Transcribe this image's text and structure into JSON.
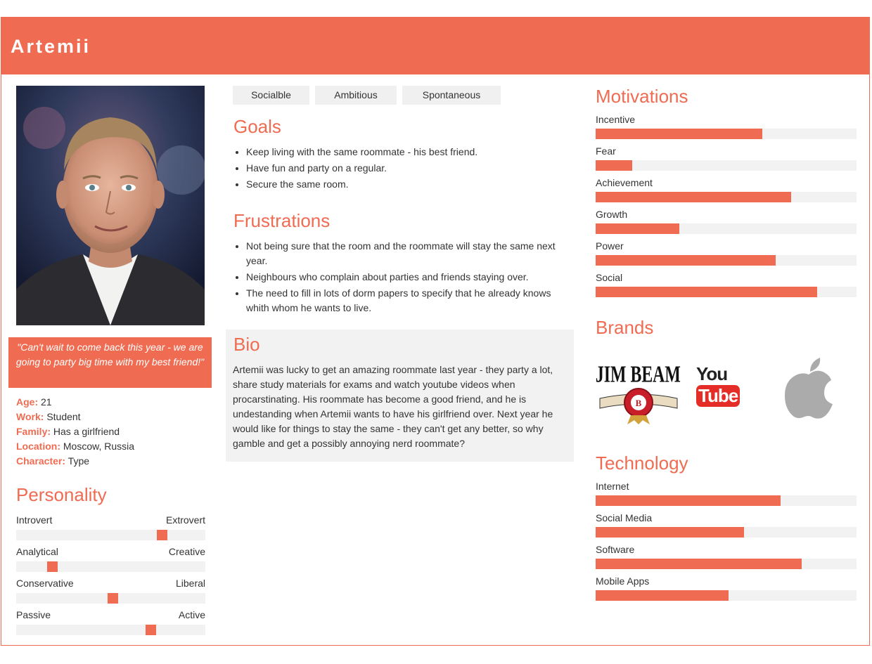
{
  "persona": {
    "name": "Artemii",
    "quote": "\"Can't wait to come back this year - we are going to party big time with my best friend!\"",
    "facts": [
      {
        "key": "Age:",
        "value": "21"
      },
      {
        "key": "Work:",
        "value": "Student"
      },
      {
        "key": "Family:",
        "value": "Has a girlfriend"
      },
      {
        "key": "Location:",
        "value": "Moscow, Russia"
      },
      {
        "key": "Character:",
        "value": "Type"
      }
    ]
  },
  "personality": {
    "title": "Personality",
    "scales": [
      {
        "left": "Introvert",
        "right": "Extrovert",
        "value": 0.77
      },
      {
        "left": "Analytical",
        "right": "Creative",
        "value": 0.19
      },
      {
        "left": "Conservative",
        "right": "Liberal",
        "value": 0.51
      },
      {
        "left": "Passive",
        "right": "Active",
        "value": 0.71
      }
    ]
  },
  "tags": [
    "Socialble",
    "Ambitious",
    "Spontaneous"
  ],
  "goals": {
    "title": "Goals",
    "items": [
      "Keep living with the same roommate - his best friend.",
      "Have fun and party on a regular.",
      "Secure the same room."
    ]
  },
  "frustrations": {
    "title": "Frustrations",
    "items": [
      "Not being sure that the room and the roommate will stay the same next year.",
      "Neighbours who complain about parties and friends staying over.",
      "The need to fill in lots of dorm papers to specify that he already knows whith whom he wants to live."
    ]
  },
  "bio": {
    "title": "Bio",
    "text": "Artemii was lucky to get an amazing roommate last year - they party a lot, share study materials for exams and watch youtube videos when procarstinating. His roommate has become a good friend, and he is undestanding when Artemii wants to have his girlfriend over. Next year he would like for things to stay the same - they can't get any better, so why gamble and get a possibly annoying nerd roommate?"
  },
  "motivations": {
    "title": "Motivations",
    "items": [
      {
        "label": "Incentive",
        "value": 0.64
      },
      {
        "label": "Fear",
        "value": 0.14
      },
      {
        "label": "Achievement",
        "value": 0.75
      },
      {
        "label": "Growth",
        "value": 0.32
      },
      {
        "label": "Power",
        "value": 0.69
      },
      {
        "label": "Social",
        "value": 0.85
      }
    ]
  },
  "brands": {
    "title": "Brands",
    "jimbeam": "JIM BEAM",
    "youtube_you": "You",
    "youtube_tube": "Tube"
  },
  "technology": {
    "title": "Technology",
    "items": [
      {
        "label": "Internet",
        "value": 0.71
      },
      {
        "label": "Social Media",
        "value": 0.57
      },
      {
        "label": "Software",
        "value": 0.79
      },
      {
        "label": "Mobile Apps",
        "value": 0.51
      }
    ]
  },
  "colors": {
    "accent": "#ef6c52",
    "track": "#f2f2f2",
    "tag_bg": "#f0f0f0"
  }
}
